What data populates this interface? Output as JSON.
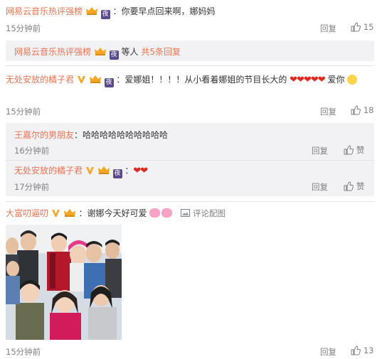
{
  "comments": [
    {
      "user": "网易云音乐热评强榜",
      "text": "：你要早点回来啊，娜妈妈",
      "time": "15分钟前",
      "reply_label": "回复",
      "likes": "15"
    },
    {
      "user": "无处安放的橘子君",
      "text_a": "：爱娜姐！！！！从小看着娜姐的节目长大的",
      "text_b": "爱你",
      "time": "15分钟前",
      "reply_label": "回复",
      "likes": "18"
    },
    {
      "user": "大富叨逼叨",
      "text": "：谢娜今天好可爱",
      "pic_label": "评论配图",
      "time": "15分钟前",
      "reply_label": "回复",
      "likes": "13"
    }
  ],
  "reply_summary": {
    "user": "网易云音乐热评强榜",
    "text": "等人",
    "link": "共5条回复"
  },
  "replies": [
    {
      "user": "王嘉尔的男朋友",
      "text": "：哈哈哈哈哈哈哈哈哈哈",
      "time": "16分钟前",
      "reply_label": "回复",
      "like_label": "赞"
    },
    {
      "user": "无处安放的橘子君",
      "text": "：",
      "time": "17分钟前",
      "reply_label": "回复",
      "like_label": "赞"
    }
  ],
  "badges": {
    "ye": "夜"
  },
  "colors": {
    "username": "#eb7350",
    "reply_bg": "#f2f2f5",
    "heart": "#e0281f"
  },
  "icons": [
    "thumbs-up-icon",
    "vip-crown-icon",
    "verified-v-icon",
    "night-badge-icon",
    "heart-icon",
    "pig-emoji-icon",
    "smile-emoji-icon",
    "picture-icon"
  ]
}
